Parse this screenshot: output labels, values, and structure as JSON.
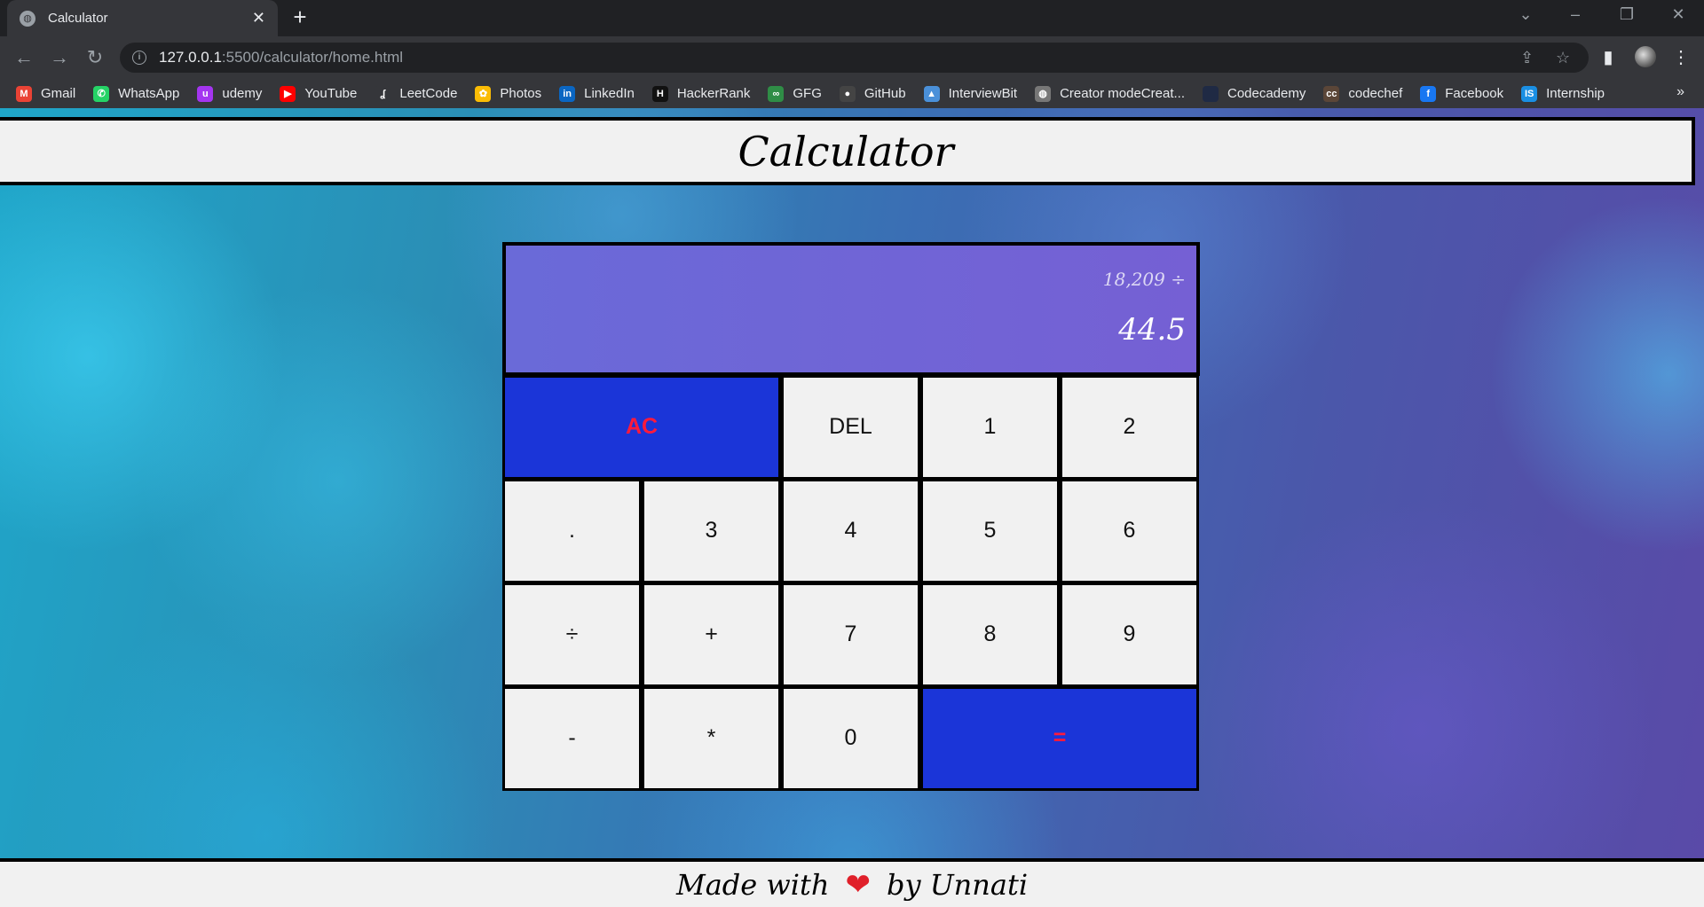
{
  "browser": {
    "tab_title": "Calculator",
    "url_host": "127.0.0.1",
    "url_path": ":5500/calculator/home.html",
    "bookmarks": [
      {
        "label": "Gmail",
        "icon": "gmail-icon",
        "color": "#ea4335",
        "glyph": "M"
      },
      {
        "label": "WhatsApp",
        "icon": "whatsapp-icon",
        "color": "#25d366",
        "glyph": "✆"
      },
      {
        "label": "udemy",
        "icon": "udemy-icon",
        "color": "#a435f0",
        "glyph": "u"
      },
      {
        "label": "YouTube",
        "icon": "youtube-icon",
        "color": "#ff0000",
        "glyph": "▶"
      },
      {
        "label": "LeetCode",
        "icon": "leetcode-icon",
        "color": "#35363a",
        "glyph": "ʆ"
      },
      {
        "label": "Photos",
        "icon": "photos-icon",
        "color": "#fbbc04",
        "glyph": "✿"
      },
      {
        "label": "LinkedIn",
        "icon": "linkedin-icon",
        "color": "#0a66c2",
        "glyph": "in"
      },
      {
        "label": "HackerRank",
        "icon": "hackerrank-icon",
        "color": "#111111",
        "glyph": "H"
      },
      {
        "label": "GFG",
        "icon": "gfg-icon",
        "color": "#2f8d46",
        "glyph": "∞"
      },
      {
        "label": "GitHub",
        "icon": "github-icon",
        "color": "#444444",
        "glyph": "●"
      },
      {
        "label": "InterviewBit",
        "icon": "interviewbit-icon",
        "color": "#4a90d9",
        "glyph": "▲"
      },
      {
        "label": "Creator modeCreat...",
        "icon": "creator-mode-icon",
        "color": "#777777",
        "glyph": "◍"
      },
      {
        "label": "Codecademy",
        "icon": "codecademy-icon",
        "color": "#1f2a44",
        "glyph": " "
      },
      {
        "label": "codechef",
        "icon": "codechef-icon",
        "color": "#5b4638",
        "glyph": "cc"
      },
      {
        "label": "Facebook",
        "icon": "facebook-icon",
        "color": "#1877f2",
        "glyph": "f"
      },
      {
        "label": "Internship",
        "icon": "internship-icon",
        "color": "#1a8fe3",
        "glyph": "IS"
      }
    ],
    "more_label": "»"
  },
  "page": {
    "title": "Calculator",
    "footer_prefix": "Made with",
    "footer_suffix": "by Unnati"
  },
  "calculator": {
    "previous_operand": "18,209 ÷",
    "current_operand": "44.5",
    "keys": [
      "AC",
      "DEL",
      "1",
      "2",
      ".",
      "3",
      "4",
      "5",
      "6",
      "÷",
      "+",
      "7",
      "8",
      "9",
      "-",
      "*",
      "0",
      "="
    ]
  },
  "colors": {
    "accent_key": "#1b35d8",
    "accent_key_text": "#ff1a3c",
    "display_bg": "#7060d6",
    "heart": "#e0202a"
  }
}
